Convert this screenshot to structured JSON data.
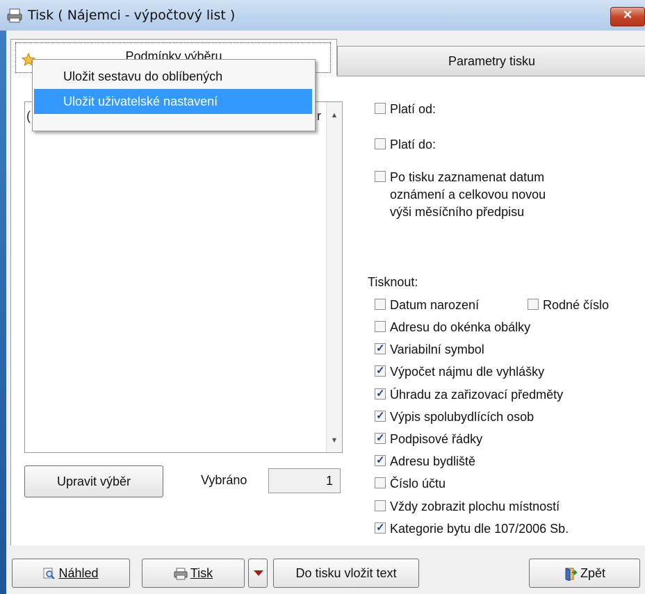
{
  "window": {
    "title": "Tisk ( Nájemci - výpočtový list )",
    "close_label": "✕"
  },
  "tabs": [
    {
      "label": "Podmínky výběru",
      "active": true
    },
    {
      "label": "Parametry tisku",
      "active": false
    }
  ],
  "context_menu": {
    "items": [
      {
        "label": "Uložit sestavu do oblíbených",
        "highlighted": false
      },
      {
        "label": "Uložit uživatelské nastavení",
        "highlighted": true
      }
    ]
  },
  "list": {
    "left_fragment": "(",
    "right_fragment": "r"
  },
  "upravit_button": "Upravit výběr",
  "vybrano": {
    "label": "Vybráno",
    "value": "1"
  },
  "options": [
    {
      "label": "Platí od:",
      "checked": false
    },
    {
      "label": "Platí do:",
      "checked": false
    },
    {
      "label_lines": [
        "Po tisku zaznamenat datum",
        "oznámení a celkovou novou",
        "výši měsíčního předpisu"
      ],
      "checked": false
    }
  ],
  "tisknout_label": "Tisknout:",
  "print_items": [
    {
      "label": "Datum narození",
      "checked": false
    },
    {
      "label": "Rodné číslo",
      "checked": false
    },
    {
      "label": "Adresu do okénka obálky",
      "checked": false
    },
    {
      "label": "Variabilní symbol",
      "checked": true
    },
    {
      "label": "Výpočet nájmu dle vyhlášky",
      "checked": true
    },
    {
      "label": "Úhradu za zařizovací předměty",
      "checked": true
    },
    {
      "label": "Výpis spolubydlících osob",
      "checked": true
    },
    {
      "label": "Podpisové řádky",
      "checked": true
    },
    {
      "label": "Adresu bydliště",
      "checked": true
    },
    {
      "label": "Číslo účtu",
      "checked": false
    },
    {
      "label": "Vždy zobrazit plochu místností",
      "checked": false
    },
    {
      "label": "Kategorie bytu dle 107/2006 Sb.",
      "checked": true
    }
  ],
  "bottom_buttons": {
    "nahled": "Náhled",
    "tisk": "Tisk",
    "vlozit": "Do tisku vložit text",
    "zpet": "Zpět"
  },
  "colors": {
    "menu_highlight": "#3399ff",
    "close_button": "#c8452a",
    "check_mark": "#1f3f8f"
  }
}
